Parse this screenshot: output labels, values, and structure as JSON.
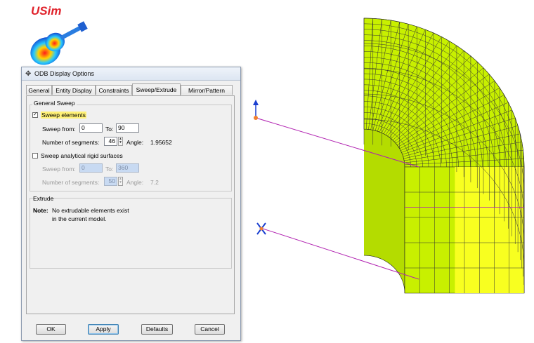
{
  "logo": {
    "text": "USim"
  },
  "dialog": {
    "title": "ODB Display Options",
    "tabs": [
      {
        "label": "General"
      },
      {
        "label": "Entity Display"
      },
      {
        "label": "Constraints"
      },
      {
        "label": "Sweep/Extrude",
        "active": true
      },
      {
        "label": "Mirror/Pattern"
      }
    ],
    "general_sweep": {
      "title": "General Sweep",
      "sweep_elements": {
        "label": "Sweep elements",
        "checked": true
      },
      "sweep_from_label": "Sweep from:",
      "sweep_from": "0",
      "to_label": "To:",
      "to": "90",
      "segments_label": "Number of segments:",
      "segments": "46",
      "angle_label": "Angle:",
      "angle": "1.95652",
      "sweep_rigid": {
        "label": "Sweep analytical rigid surfaces",
        "checked": false
      },
      "rigid_from_label": "Sweep from:",
      "rigid_from": "0",
      "rigid_to_label": "To:",
      "rigid_to": "360",
      "rigid_segments_label": "Number of segments:",
      "rigid_segments": "50",
      "rigid_angle_label": "Angle:",
      "rigid_angle": "7.2"
    },
    "extrude": {
      "title": "Extrude",
      "note_label": "Note:",
      "note_line1": "No extrudable elements exist",
      "note_line2": "in the current model."
    },
    "buttons": {
      "ok": "OK",
      "apply": "Apply",
      "defaults": "Defaults",
      "cancel": "Cancel"
    }
  },
  "colors": {
    "mesh_fill": "#c8f000",
    "mesh_highlight": "#f8ff20",
    "edge_line": "#b020b0"
  }
}
